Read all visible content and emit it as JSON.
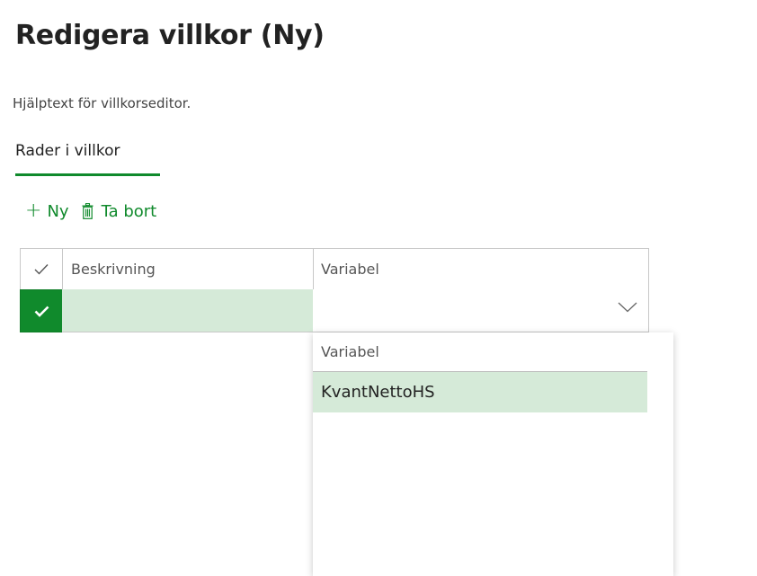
{
  "page": {
    "title": "Redigera villkor (Ny)",
    "help_text": "Hjälptext för villkorseditor."
  },
  "tabs": [
    {
      "label": "Rader i villkor",
      "selected": true
    }
  ],
  "toolbar": {
    "new_label": "Ny",
    "delete_label": "Ta bort"
  },
  "grid": {
    "columns": [
      "Beskrivning",
      "Variabel"
    ],
    "rows": [
      {
        "selected": true,
        "beskrivning": "",
        "variabel": ""
      }
    ]
  },
  "dropdown": {
    "header": "Variabel",
    "options": [
      "KvantNettoHS"
    ]
  },
  "colors": {
    "accent": "#108a2c",
    "row_highlight": "#d5ead8"
  },
  "icons": {
    "new": "plus-icon",
    "delete": "trash-icon",
    "select_all": "checkmark-icon",
    "row_selected": "checkmark-icon",
    "lookup": "chevron-down-icon"
  }
}
